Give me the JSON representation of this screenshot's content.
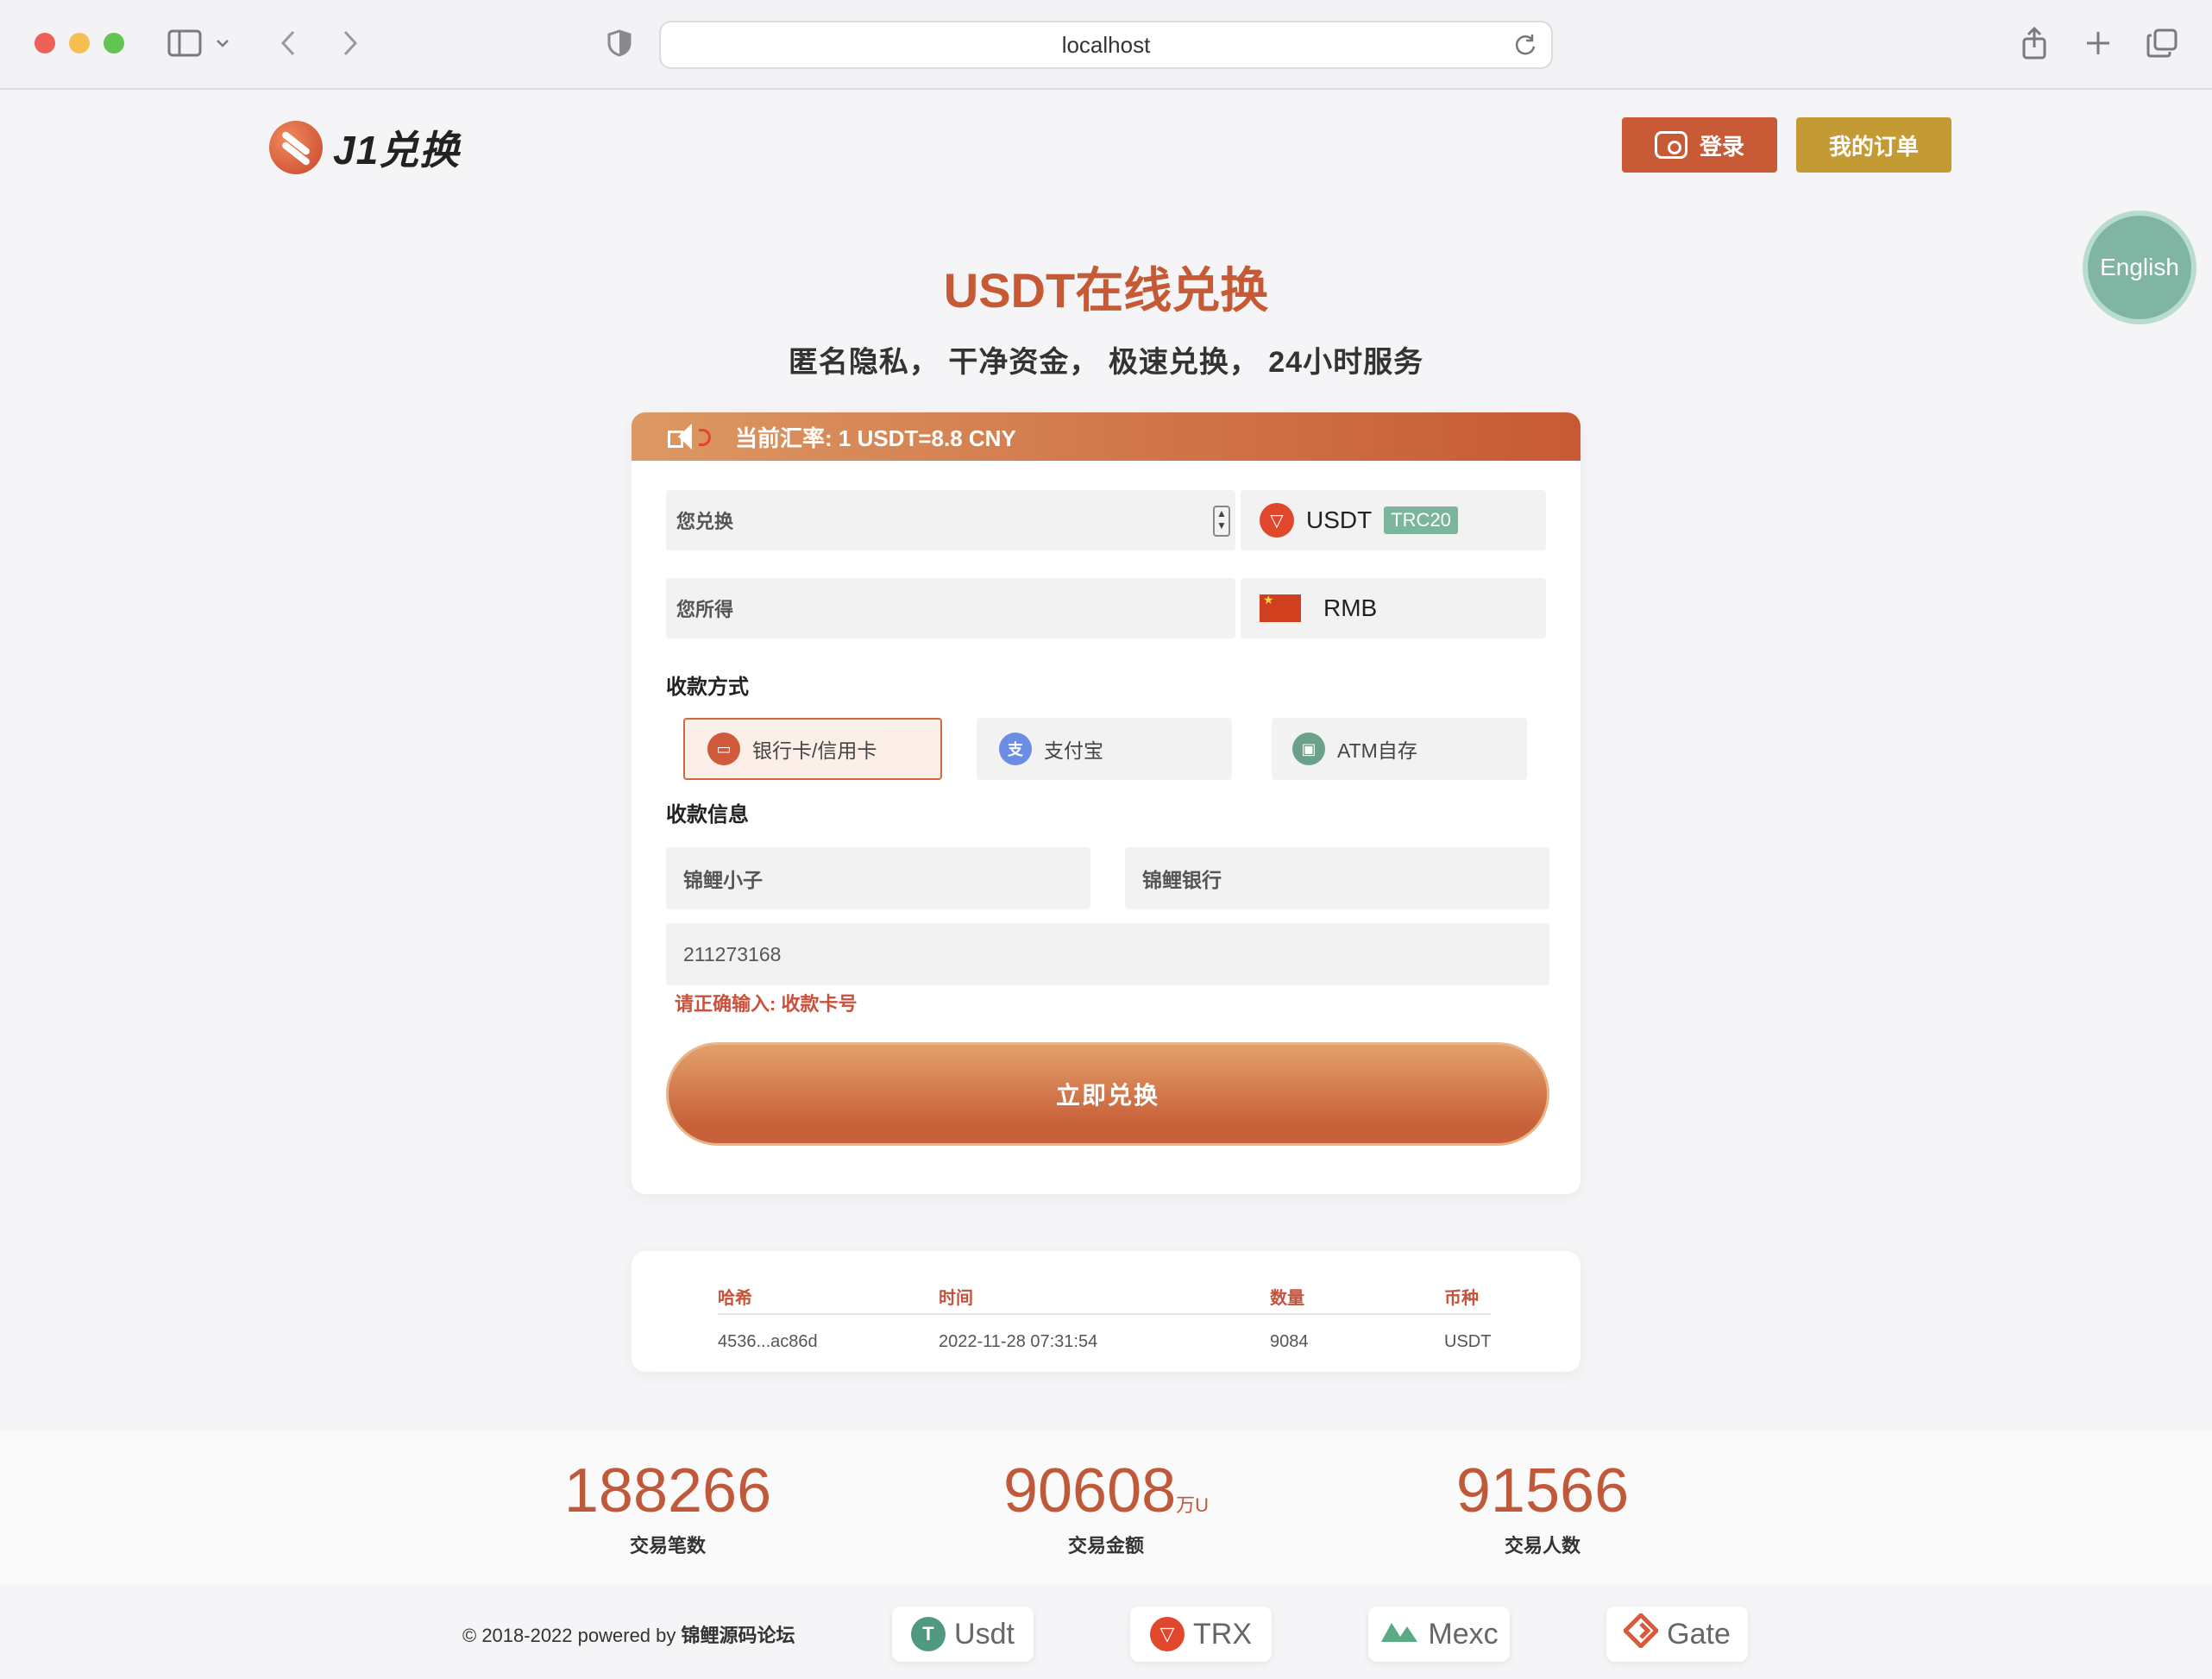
{
  "browser": {
    "url": "localhost"
  },
  "header": {
    "logo_text": "J1兑换",
    "login_label": "登录",
    "orders_label": "我的订单",
    "language_label": "English"
  },
  "hero": {
    "title": "USDT在线兑换",
    "subtitle": "匿名隐私， 干净资金， 极速兑换， 24小时服务"
  },
  "exchange": {
    "rate_text": "当前汇率: 1 USDT=8.8 CNY",
    "you_pay_placeholder": "您兑换",
    "you_get_placeholder": "您所得",
    "pay_coin": "USDT",
    "pay_network": "TRC20",
    "get_currency": "RMB",
    "payment_method_label": "收款方式",
    "payment_methods": [
      "银行卡/信用卡",
      "支付宝",
      "ATM自存"
    ],
    "selected_method": "银行卡/信用卡",
    "payee_info_label": "收款信息",
    "payee_name": "锦鲤小子",
    "payee_bank": "锦鲤银行",
    "card_number": "211273168",
    "error_text": "请正确输入: 收款卡号",
    "submit_label": "立即兑换"
  },
  "transactions": {
    "headers": [
      "哈希",
      "时间",
      "数量",
      "币种"
    ],
    "rows": [
      {
        "hash": "4536...ac86d",
        "time": "2022-11-28 07:31:54",
        "amount": "9084",
        "coin": "USDT"
      }
    ]
  },
  "stats": [
    {
      "value": "188266",
      "unit": "",
      "label": "交易笔数"
    },
    {
      "value": "90608",
      "unit": "万U",
      "label": "交易金额"
    },
    {
      "value": "91566",
      "unit": "",
      "label": "交易人数"
    }
  ],
  "footer": {
    "copyright": "© 2018-2022 powered by ",
    "powered_by": "锦鲤源码论坛",
    "partners": [
      "Usdt",
      "TRX",
      "Mexc",
      "Gate"
    ]
  },
  "colors": {
    "accent": "#c55a35",
    "gold": "#c49a35",
    "teal": "#7fb5a2"
  }
}
